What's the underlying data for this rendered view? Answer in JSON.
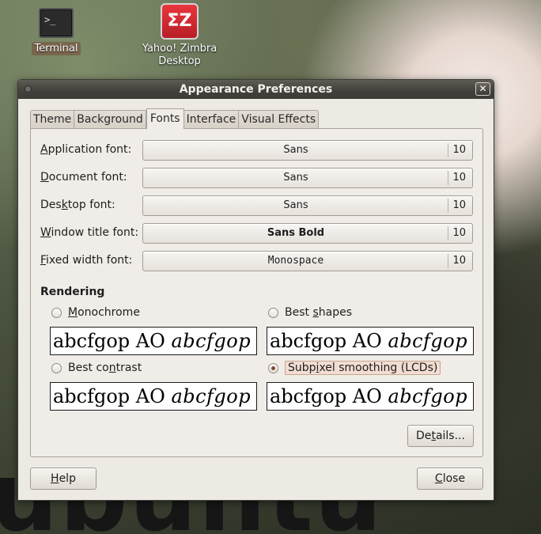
{
  "desktop": {
    "terminal_label": "Terminal",
    "terminal_glyph": ">_",
    "zimbra_label_line1": "Yahoo! Zimbra",
    "zimbra_label_line2": "Desktop",
    "zimbra_glyph": "ΣZ",
    "watermark": "ubuntu"
  },
  "window": {
    "title": "Appearance Preferences",
    "close_glyph": "✕"
  },
  "tabs": [
    {
      "label": "Theme"
    },
    {
      "label": "Background"
    },
    {
      "label": "Fonts",
      "active": true
    },
    {
      "label": "Interface"
    },
    {
      "label": "Visual Effects"
    }
  ],
  "fonts": {
    "application": {
      "pre": "",
      "mnemonic": "A",
      "post": "pplication font:",
      "name": "Sans",
      "size": "10"
    },
    "document": {
      "pre": "",
      "mnemonic": "D",
      "post": "ocument font:",
      "name": "Sans",
      "size": "10"
    },
    "desktop": {
      "pre": "Des",
      "mnemonic": "k",
      "post": "top font:",
      "name": "Sans",
      "size": "10"
    },
    "window_title": {
      "pre": "",
      "mnemonic": "W",
      "post": "indow title font:",
      "name": "Sans Bold",
      "size": "10"
    },
    "fixed_width": {
      "pre": "",
      "mnemonic": "F",
      "post": "ixed width font:",
      "name": "Monospace",
      "size": "10"
    }
  },
  "rendering": {
    "heading": "Rendering",
    "sample_regular": "abcfgop AO ",
    "sample_italic": "abcfgop",
    "monochrome": {
      "pre": "",
      "mnemonic": "M",
      "post": "onochrome",
      "selected": false
    },
    "best_shapes": {
      "pre": "Best ",
      "mnemonic": "s",
      "post": "hapes",
      "selected": false
    },
    "best_contrast": {
      "pre": "Best co",
      "mnemonic": "n",
      "post": "trast",
      "selected": false
    },
    "subpixel": {
      "pre": "Subp",
      "mnemonic": "i",
      "post": "xel smoothing (LCDs)",
      "selected": true
    }
  },
  "buttons": {
    "details": {
      "pre": "De",
      "mnemonic": "t",
      "post": "ails..."
    },
    "help": {
      "pre": "",
      "mnemonic": "H",
      "post": "elp"
    },
    "close": {
      "pre": "",
      "mnemonic": "C",
      "post": "lose"
    }
  }
}
